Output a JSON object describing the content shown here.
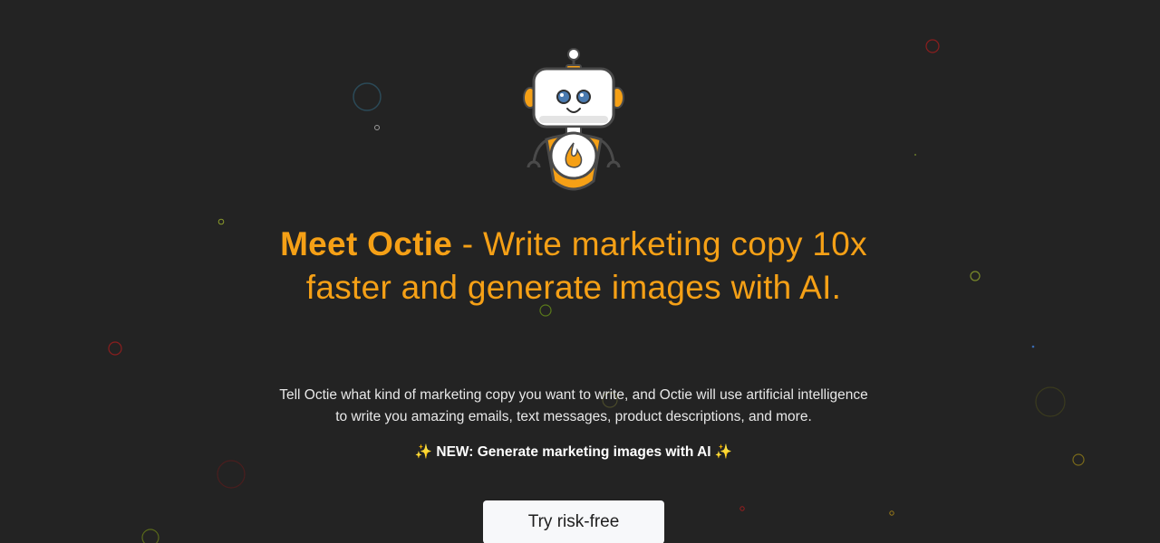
{
  "hero": {
    "brand_name": "Meet Octie",
    "headline_rest": " - Write marketing copy 10x faster and generate images with AI.",
    "description": "Tell Octie what kind of marketing copy you want to write, and Octie will use artificial intelligence to write you amazing emails, text messages, product descriptions, and more.",
    "new_banner": {
      "sparkle_left": "✨",
      "text": " NEW: Generate marketing images with AI ",
      "sparkle_right": "✨"
    },
    "cta_label": "Try risk-free"
  },
  "mascot": {
    "icon": "robot-mascot-icon",
    "chest_icon": "flame-icon"
  },
  "colors": {
    "background": "#232323",
    "accent": "#f5a016",
    "text": "#e8e8e8",
    "button_bg": "#f7f8fa"
  }
}
